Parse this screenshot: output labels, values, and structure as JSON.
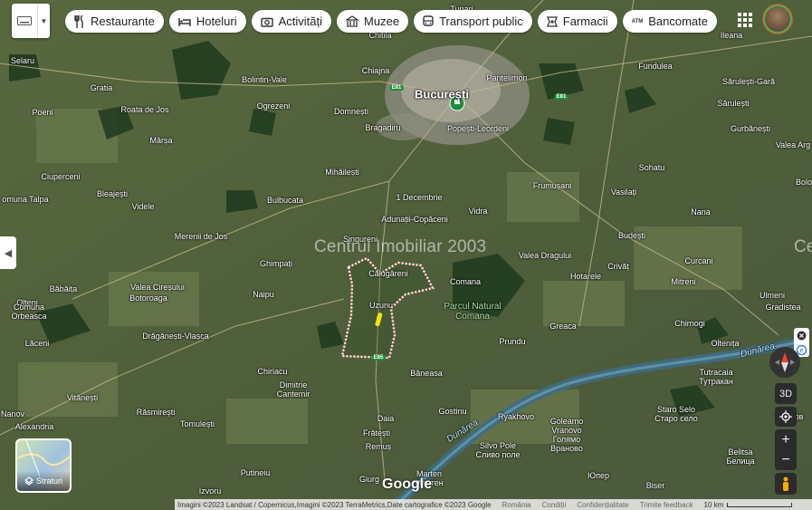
{
  "toolbar": {
    "chips": [
      {
        "label": "Restaurante",
        "icon": "fork-knife-icon"
      },
      {
        "label": "Hoteluri",
        "icon": "bed-icon"
      },
      {
        "label": "Activități",
        "icon": "camera-icon"
      },
      {
        "label": "Muzee",
        "icon": "museum-icon"
      },
      {
        "label": "Transport public",
        "icon": "bus-icon"
      },
      {
        "label": "Farmacii",
        "icon": "pharmacy-icon"
      },
      {
        "label": "Bancomate",
        "icon": "atm-icon"
      }
    ],
    "atm_glyph": "ATM"
  },
  "map": {
    "watermark": "Centrul Imobiliar 2003",
    "watermark_edge": "Ce",
    "places": {
      "capital": "București",
      "tunari": "Tunari",
      "chitila": "Chitila",
      "ileana": "Ileana",
      "selaru": "Selaru",
      "chiajna": "Chiajna",
      "pantelimon": "Pantelimon",
      "fundulea": "Fundulea",
      "gratia": "Gratia",
      "bolintin": "Bolintin-Vale",
      "sarulesti_gara": "Sărulești-Gară",
      "poeni": "Poeni",
      "roata": "Roata de Jos",
      "ogrezeni": "Ogrezeni",
      "domnesti": "Domnești",
      "sarulesti": "Sărulești",
      "marsa": "Mârșa",
      "bragadiru": "Bragadiru",
      "popesti": "Popești-Leordeni",
      "gurbanesti": "Gurbănești",
      "valea_arg": "Valea Arg",
      "ciuperceni": "Ciuperceni",
      "mihailesti": "Mihăilești",
      "sohatu": "Sohatu",
      "bolo": "Bolo",
      "comuna_talpa": "omuna Talpa",
      "bleajesti": "Bleajești",
      "bulbucata": "Bulbucata",
      "decembrie": "1 Decembrie",
      "frumusani": "Frumușani",
      "vasilati": "Vasilați",
      "videle": "Videle",
      "vidra": "Vidra",
      "nana": "Nana",
      "adunatii": "Adunații-Copăceni",
      "merenii": "Merenii de Jos",
      "singureni": "Singureni",
      "budesti": "Budești",
      "valea_dragului": "Valea Dragului",
      "ghimpati": "Ghimpați",
      "calugareni": "Călugăreni",
      "hotarele": "Hotarele",
      "crivat": "Crivăț",
      "curcani": "Curcani",
      "comana": "Comana",
      "mitreni": "Mitreni",
      "babaita": "Băbăița",
      "valea_ciresului": "Valea Cireșului",
      "olteni": "Olteni",
      "botoroaga": "Botoroaga",
      "naipu": "Naipu",
      "uzunu": "Uzunu",
      "ulmeni": "Ulmeni",
      "gradistea": "Gradistea",
      "orbeasca": "Comuna\nOrbeasca",
      "parc_natural": "Parcul Natural\nComana",
      "greaca": "Greaca",
      "chirnogi": "Chirnogi",
      "draganesti": "Drăgănești-Vlașca",
      "laceni": "Lăceni",
      "prundu": "Prundu",
      "oltenita": "Oltenița",
      "chiriacu": "Chiriacu",
      "baneasa": "Băneasa",
      "tutracaia": "Tutracaia\nТутракан",
      "dimitrie_cantemir": "Dimitrie\nCantemir",
      "vitanesti": "Vitănești",
      "rasmiresti": "Răsmirești",
      "gostinu": "Gostinu",
      "staro_selo": "Staro Selo\nСтаро село",
      "tarnov": "Търнов",
      "nanov": "Nanov",
      "tomulesti": "Tomulești",
      "daia": "Daia",
      "ryakhovo": "Ryakhovo",
      "goleamo": "Goleamo\nVranovo\nГолямо\nВраново",
      "alexandria": "Alexandria",
      "fratesti": "Frătești",
      "remus": "Remuș",
      "silvo_pole": "Silvo Pole\nСливо поле",
      "belitsa": "Belitsa\nБелица",
      "putineiu": "Putineiu",
      "marten": "Marten\nМартен",
      "yupe": "Юпер",
      "izvoru": "Izvoru",
      "giurgiu": "Giurg",
      "bileshi": "Biser",
      "river1": "Dunărea",
      "river2": "Dunărea"
    },
    "roads": [
      "E81",
      "E81",
      "E85"
    ],
    "logo": "Google"
  },
  "layers": {
    "label": "Straturi"
  },
  "controls": {
    "zoom_in": "+",
    "zoom_out": "−",
    "three_d": "3D"
  },
  "footer": {
    "attribution": "Imagini ©2023 Landsat / Copernicus,Imagini ©2023 TerraMetrics,Date cartografice ©2023 Google",
    "country": "România",
    "terms": "Condiții",
    "privacy": "Confidențialitate",
    "feedback": "Trimite feedback",
    "scale": "10 km"
  },
  "colors": {
    "accent": "#1a73e8",
    "marker": "#1e8e3e",
    "boundary": "#e05050",
    "highlight": "#f4e21a"
  }
}
